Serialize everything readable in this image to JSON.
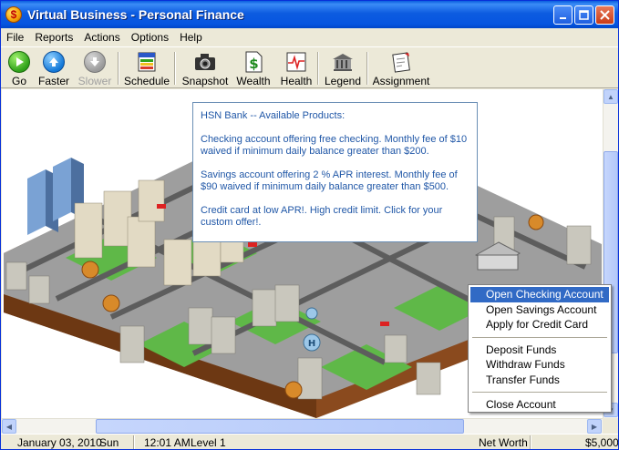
{
  "window": {
    "title": "Virtual Business - Personal Finance",
    "app_icon_letter": "$"
  },
  "menu": [
    "File",
    "Reports",
    "Actions",
    "Options",
    "Help"
  ],
  "toolbar": {
    "go": "Go",
    "faster": "Faster",
    "slower": "Slower",
    "schedule": "Schedule",
    "snapshot": "Snapshot",
    "wealth": "Wealth",
    "health": "Health",
    "legend": "Legend",
    "assignment": "Assignment"
  },
  "tooltip": {
    "heading": "HSN Bank -- Available Products:",
    "checking": "Checking account offering free checking. Monthly fee of $10 waived if minimum daily balance greater than $200.",
    "savings": "Savings account offering 2 % APR interest. Monthly fee of $90 waived if minimum daily balance greater than $500.",
    "credit": "Credit card at low APR!. High credit limit. Click for your custom offer!."
  },
  "context_menu": {
    "items": [
      "Open Checking Account",
      "Open Savings Account",
      "Apply for Credit Card",
      "Deposit Funds",
      "Withdraw Funds",
      "Transfer Funds",
      "Close Account"
    ],
    "highlighted_index": 0
  },
  "status": {
    "date": "January 03, 2010",
    "day": "Sun",
    "time": "12:01 AM",
    "level": "Level 1",
    "net_worth_label": "Net Worth",
    "net_worth_value": "$5,000"
  },
  "colors": {
    "title_bar": "#0a5ddf",
    "tooltip_text": "#2057a7",
    "menu_highlight": "#316ac5",
    "grass": "#5fb848",
    "road": "#5d5d5d",
    "dirt": "#8a4a1e"
  },
  "icons": {
    "go": "play-icon",
    "faster": "up-arrow-icon",
    "slower": "down-arrow-icon",
    "schedule": "calendar-icon",
    "snapshot": "camera-icon",
    "wealth": "dollar-document-icon",
    "health": "heart-monitor-icon",
    "legend": "legend-icon",
    "assignment": "assignment-icon"
  }
}
